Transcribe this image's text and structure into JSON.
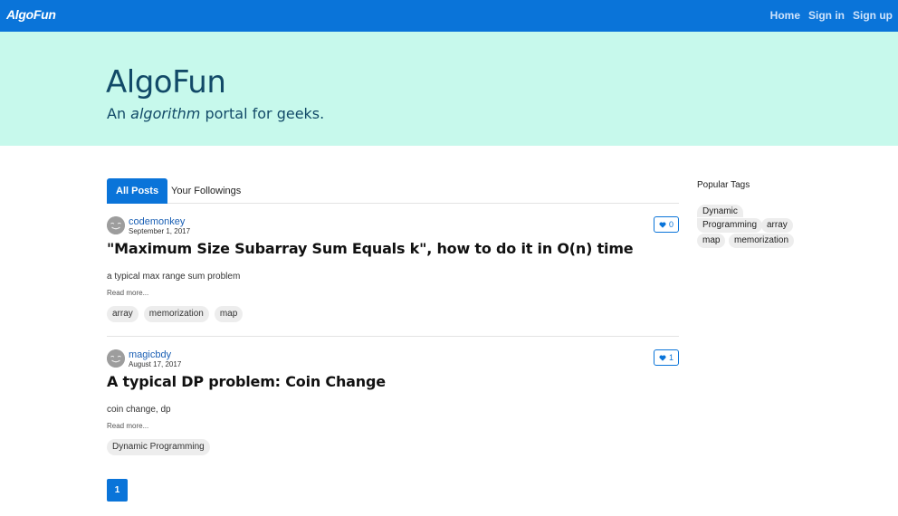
{
  "navbar": {
    "brand": "AlgoFun",
    "links": [
      "Home",
      "Sign in",
      "Sign up"
    ]
  },
  "hero": {
    "title": "AlgoFun",
    "subtitle_before": "An ",
    "subtitle_em": "algorithm",
    "subtitle_after": " portal for geeks."
  },
  "tabs": {
    "all_posts": "All Posts",
    "followings": "Your Followings"
  },
  "posts": [
    {
      "author": "codemonkey",
      "date": "September 1, 2017",
      "likes": "0",
      "title": "\"Maximum Size Subarray Sum Equals k\", how to do it in O(n) time",
      "excerpt": "a typical max range sum problem",
      "read_more": "Read more...",
      "tags": [
        "array",
        "memorization",
        "map"
      ]
    },
    {
      "author": "magicbdy",
      "date": "August 17, 2017",
      "likes": "1",
      "title": "A typical DP problem: Coin Change",
      "excerpt": "coin change, dp",
      "read_more": "Read more...",
      "tags": [
        "Dynamic Programming"
      ]
    }
  ],
  "pagination": {
    "current_page": "1"
  },
  "sidebar": {
    "title": "Popular Tags",
    "tags": [
      "Dynamic Programming",
      "array",
      "map",
      "memorization"
    ],
    "dynamic_line1": "Dynamic",
    "dynamic_line2": "Programming"
  },
  "colors": {
    "navbar": "#0a74d9",
    "hero_bg": "#c7f9ec",
    "hero_text": "#124a68"
  },
  "icons": {
    "heart": "heart-icon",
    "avatar": "smiley-avatar-icon"
  }
}
